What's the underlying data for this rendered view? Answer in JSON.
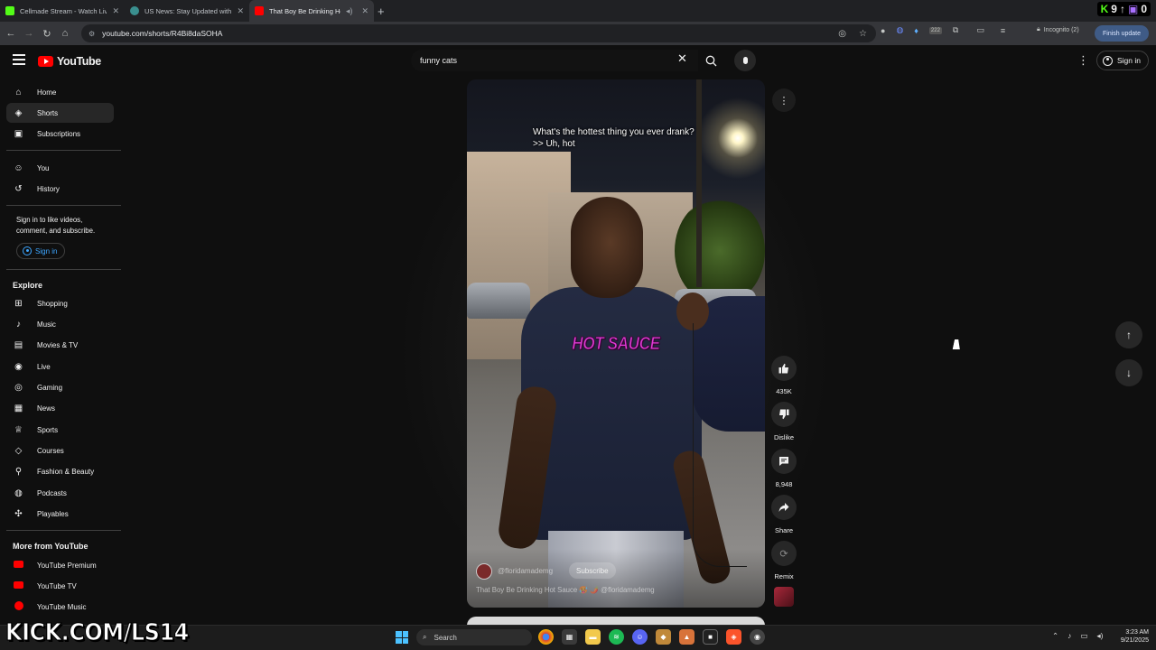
{
  "browser": {
    "tabs": [
      {
        "title": "Cellmade Stream - Watch Live",
        "favicon_color": "#53fc18",
        "active": false
      },
      {
        "title": "US News: Stay Updated with the",
        "favicon_color": "#3a8f8f",
        "active": false
      },
      {
        "title": "That Boy Be Drinking Hot S",
        "favicon_color": "#ff0000",
        "active": true
      }
    ],
    "new_tab": "+",
    "url": "youtube.com/shorts/R4Bi8daSOHA",
    "incognito_label": "Incognito (2)",
    "finish_update_label": "Finish update",
    "extension_badge": "222",
    "overlay_count_1": "9",
    "overlay_count_2": "0"
  },
  "header": {
    "logo_text": "YouTube",
    "search_value": "funny cats",
    "signin_label": "Sign in"
  },
  "sidebar": {
    "primary": [
      {
        "label": "Home",
        "icon": "home-icon",
        "glyph": "⌂"
      },
      {
        "label": "Shorts",
        "icon": "shorts-icon",
        "glyph": "◈"
      },
      {
        "label": "Subscriptions",
        "icon": "subscriptions-icon",
        "glyph": "▣"
      }
    ],
    "you": [
      {
        "label": "You",
        "icon": "user-icon",
        "glyph": "☺"
      },
      {
        "label": "History",
        "icon": "history-icon",
        "glyph": "↺"
      }
    ],
    "signin_note": "Sign in to like videos, comment, and subscribe.",
    "signin_label": "Sign in",
    "explore_heading": "Explore",
    "explore": [
      {
        "label": "Shopping",
        "icon": "shopping-bag-icon",
        "glyph": "⊞"
      },
      {
        "label": "Music",
        "icon": "music-note-icon",
        "glyph": "♪"
      },
      {
        "label": "Movies & TV",
        "icon": "clapperboard-icon",
        "glyph": "▤"
      },
      {
        "label": "Live",
        "icon": "live-icon",
        "glyph": "◉"
      },
      {
        "label": "Gaming",
        "icon": "gamepad-icon",
        "glyph": "◎"
      },
      {
        "label": "News",
        "icon": "newspaper-icon",
        "glyph": "▦"
      },
      {
        "label": "Sports",
        "icon": "trophy-icon",
        "glyph": "♕"
      },
      {
        "label": "Courses",
        "icon": "courses-icon",
        "glyph": "◇"
      },
      {
        "label": "Fashion & Beauty",
        "icon": "hanger-icon",
        "glyph": "⚲"
      },
      {
        "label": "Podcasts",
        "icon": "podcast-icon",
        "glyph": "◍"
      },
      {
        "label": "Playables",
        "icon": "playables-icon",
        "glyph": "✣"
      }
    ],
    "more_heading": "More from YouTube",
    "more": [
      {
        "label": "YouTube Premium",
        "icon": "youtube-premium-icon"
      },
      {
        "label": "YouTube TV",
        "icon": "youtube-tv-icon"
      },
      {
        "label": "YouTube Music",
        "icon": "youtube-music-icon"
      }
    ]
  },
  "short": {
    "caption_line1": "What's the hottest thing you ever drank?",
    "caption_line2": ">> Uh, hot",
    "overlay_text": "HOT SAUCE",
    "channel": "@floridamademg",
    "subscribe_label": "Subscribe",
    "title": "That Boy Be Drinking Hot Sauce 🥵 🌶️ @floridamademg",
    "actions": {
      "like_count": "435K",
      "dislike_label": "Dislike",
      "comment_count": "8,948",
      "share_label": "Share",
      "remix_label": "Remix"
    }
  },
  "taskbar": {
    "search_placeholder": "Search",
    "time": "3:23 AM",
    "date": "9/21/2025",
    "stream_banner": "KICK.COM/LS14"
  },
  "colors": {
    "yt_red": "#ff0000",
    "kick_green": "#53fc18",
    "hot_sauce_magenta": "#e23bd6"
  }
}
